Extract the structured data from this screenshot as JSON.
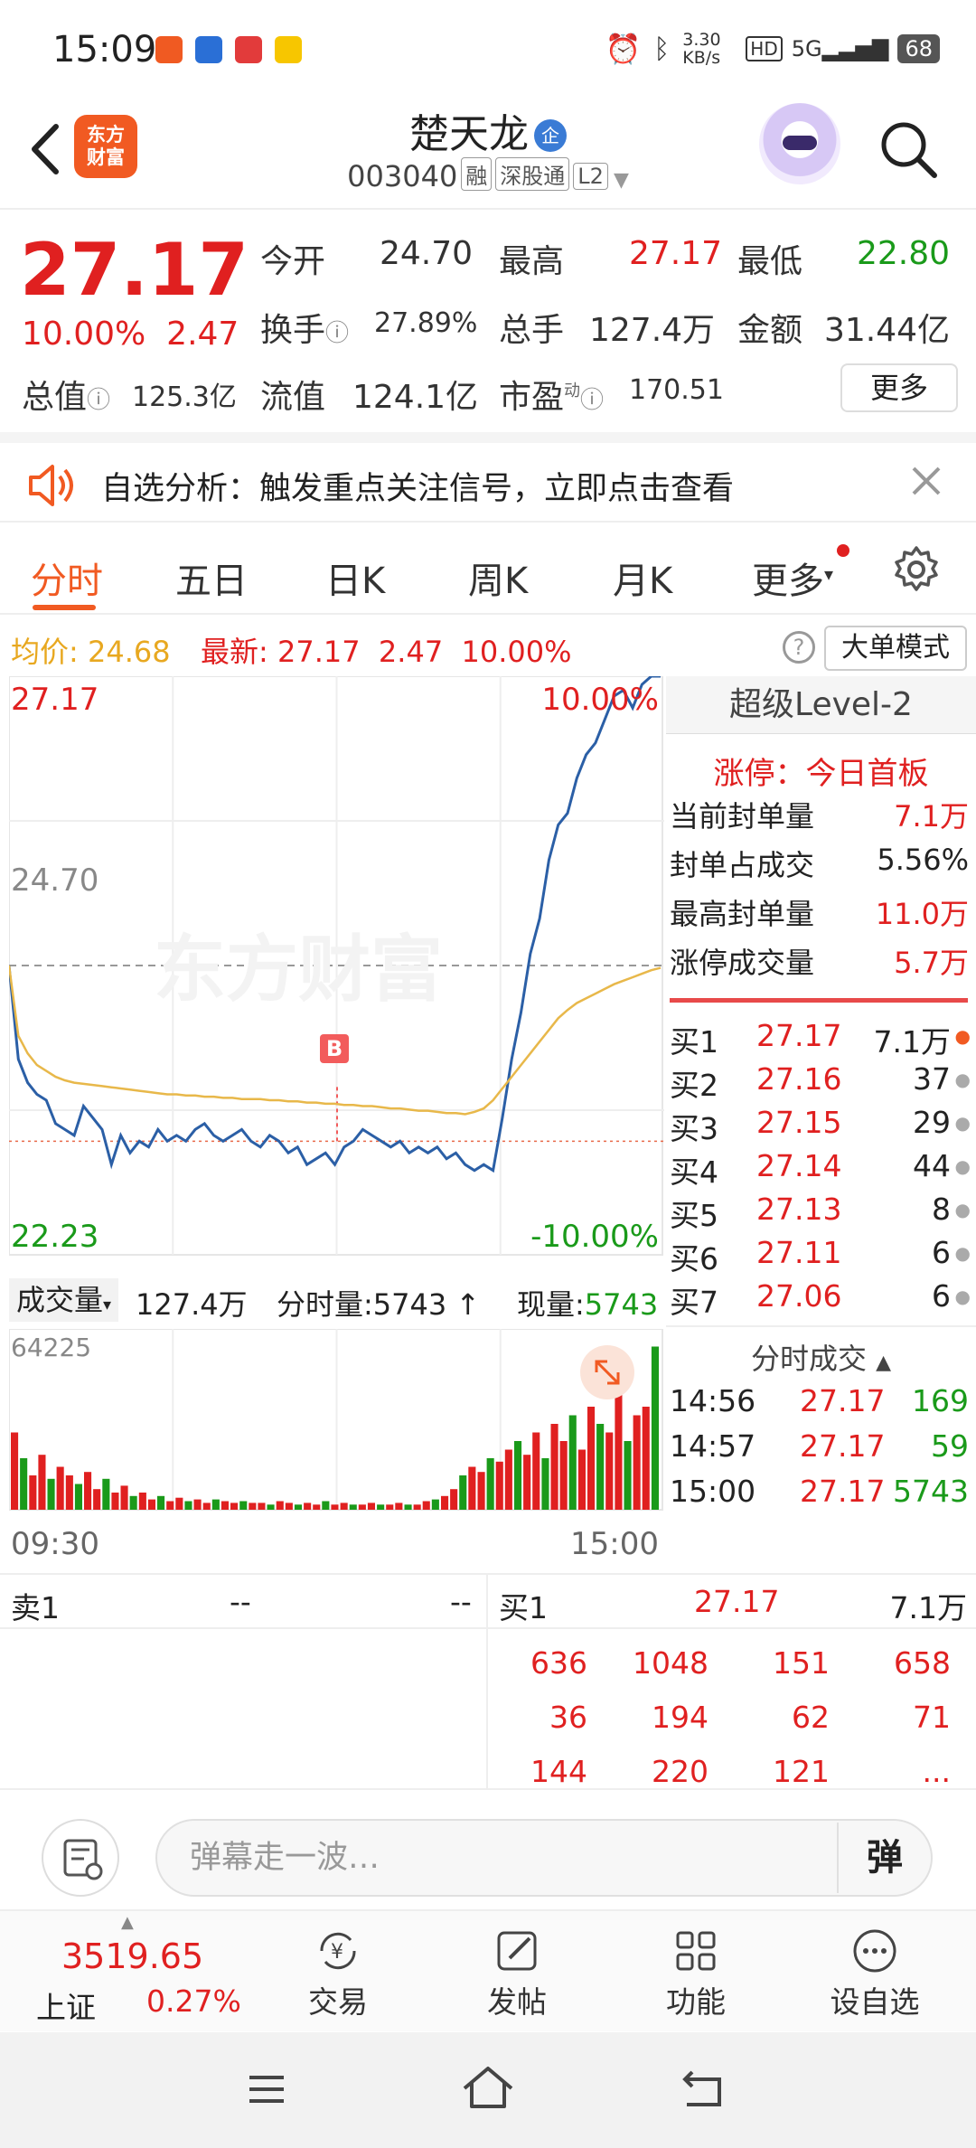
{
  "status_bar": {
    "time": "15:09",
    "net_speed": "3.30 KB/s",
    "battery": "68"
  },
  "header": {
    "logo_line1": "东方",
    "logo_line2": "财富",
    "stock_name": "楚天龙",
    "name_badge": "企",
    "stock_code": "003040",
    "tags": [
      "融",
      "深股通",
      "L2"
    ]
  },
  "quote": {
    "price": "27.17",
    "change_pct": "10.00%",
    "change": "2.47",
    "open_label": "今开",
    "open": "24.70",
    "high_label": "最高",
    "high": "27.17",
    "low_label": "最低",
    "low": "22.80",
    "turnover_label": "换手",
    "turnover": "27.89%",
    "volume_label": "总手",
    "volume": "127.4万",
    "amount_label": "金额",
    "amount": "31.44亿",
    "mcap_label": "总值",
    "mcap": "125.3亿",
    "float_label": "流值",
    "float_cap": "124.1亿",
    "pe_label": "市盈",
    "pe_sup": "动",
    "pe": "170.51",
    "more": "更多"
  },
  "notice": {
    "text": "自选分析：触发重点关注信号，立即点击查看"
  },
  "tabs": [
    "分时",
    "五日",
    "日K",
    "周K",
    "月K",
    "更多"
  ],
  "info_line": {
    "avg_label": "均价:",
    "avg": "24.68",
    "latest_label": "最新:",
    "latest": "27.17",
    "chg": "2.47",
    "pct": "10.00%",
    "mode_btn": "大单模式"
  },
  "chart_labels": {
    "top_left": "27.17",
    "top_right": "10.00%",
    "mid_left": "24.70",
    "bottom_left": "22.23",
    "bottom_right": "-10.00%",
    "marker": "B",
    "watermark": "东方财富"
  },
  "chart_data": {
    "type": "line",
    "ylim": [
      22.23,
      27.17
    ],
    "prev_close": 24.7,
    "x_labels": [
      "09:30",
      "15:00"
    ],
    "series": [
      {
        "values": [
          24.7,
          23.9,
          23.7,
          23.6,
          23.55,
          23.35,
          23.3,
          23.25,
          23.5,
          23.4,
          23.3,
          23.0,
          23.25,
          23.1,
          23.2,
          23.15,
          23.3,
          23.2,
          23.25,
          23.2,
          23.3,
          23.35,
          23.25,
          23.2,
          23.25,
          23.3,
          23.2,
          23.15,
          23.25,
          23.2,
          23.1,
          23.15,
          23.0,
          23.05,
          23.1,
          23.0,
          23.15,
          23.2,
          23.3,
          23.25,
          23.2,
          23.15,
          23.2,
          23.1,
          23.15,
          23.1,
          23.15,
          23.05,
          23.1,
          23.0,
          22.95,
          23.0,
          22.95,
          23.4,
          23.9,
          24.3,
          24.8,
          25.1,
          25.6,
          25.9,
          26.0,
          26.3,
          26.5,
          26.6,
          26.8,
          27.0,
          27.05,
          26.9,
          27.1,
          27.17,
          27.17
        ]
      },
      {
        "values": [
          24.7,
          24.1,
          23.95,
          23.85,
          23.8,
          23.75,
          23.72,
          23.7,
          23.69,
          23.68,
          23.67,
          23.66,
          23.65,
          23.64,
          23.63,
          23.62,
          23.61,
          23.6,
          23.6,
          23.59,
          23.59,
          23.58,
          23.58,
          23.57,
          23.57,
          23.56,
          23.56,
          23.56,
          23.55,
          23.55,
          23.54,
          23.54,
          23.53,
          23.53,
          23.52,
          23.52,
          23.51,
          23.51,
          23.5,
          23.5,
          23.49,
          23.48,
          23.48,
          23.47,
          23.46,
          23.46,
          23.45,
          23.44,
          23.44,
          23.43,
          23.45,
          23.48,
          23.55,
          23.65,
          23.75,
          23.85,
          23.95,
          24.05,
          24.15,
          24.25,
          24.32,
          24.38,
          24.42,
          24.46,
          24.5,
          24.54,
          24.57,
          24.6,
          24.63,
          24.66,
          24.68
        ]
      }
    ]
  },
  "volume": {
    "label": "成交量",
    "total": "127.4万",
    "tick_label": "分时量:",
    "tick_val": "5743",
    "cur_label": "现量:",
    "cur_val": "5743",
    "max_label": "64225",
    "time_start": "09:30",
    "time_end": "15:00",
    "bars": [
      0.45,
      0.3,
      0.2,
      0.32,
      0.18,
      0.25,
      0.2,
      0.15,
      0.22,
      0.12,
      0.18,
      0.1,
      0.14,
      0.08,
      0.1,
      0.06,
      0.08,
      0.05,
      0.07,
      0.05,
      0.06,
      0.04,
      0.06,
      0.05,
      0.04,
      0.05,
      0.04,
      0.04,
      0.03,
      0.05,
      0.04,
      0.03,
      0.04,
      0.03,
      0.05,
      0.03,
      0.04,
      0.03,
      0.03,
      0.04,
      0.03,
      0.03,
      0.04,
      0.03,
      0.03,
      0.05,
      0.06,
      0.08,
      0.12,
      0.2,
      0.25,
      0.22,
      0.3,
      0.28,
      0.35,
      0.4,
      0.32,
      0.45,
      0.3,
      0.5,
      0.4,
      0.55,
      0.35,
      0.6,
      0.5,
      0.45,
      0.7,
      0.4,
      0.55,
      0.6,
      0.95
    ]
  },
  "level2": {
    "title": "超级Level-2",
    "limit_label": "涨停：",
    "limit_val": "今日首板",
    "stats": [
      {
        "label": "当前封单量",
        "value": "7.1万"
      },
      {
        "label": "封单占成交",
        "value": "5.56%"
      },
      {
        "label": "最高封单量",
        "value": "11.0万"
      },
      {
        "label": "涨停成交量",
        "value": "5.7万"
      }
    ],
    "bids": [
      {
        "label": "买1",
        "price": "27.17",
        "vol": "7.1万"
      },
      {
        "label": "买2",
        "price": "27.16",
        "vol": "37"
      },
      {
        "label": "买3",
        "price": "27.15",
        "vol": "29"
      },
      {
        "label": "买4",
        "price": "27.14",
        "vol": "44"
      },
      {
        "label": "买5",
        "price": "27.13",
        "vol": "8"
      },
      {
        "label": "买6",
        "price": "27.11",
        "vol": "6"
      },
      {
        "label": "买7",
        "price": "27.06",
        "vol": "6"
      }
    ],
    "trades_title": "分时成交",
    "trades": [
      {
        "time": "14:56",
        "price": "27.17",
        "vol": "169"
      },
      {
        "time": "14:57",
        "price": "27.17",
        "vol": "59"
      },
      {
        "time": "15:00",
        "price": "27.17",
        "vol": "5743"
      }
    ]
  },
  "book": {
    "sell_label": "卖1",
    "sell_price": "--",
    "sell_vol": "--",
    "buy_label": "买1",
    "buy_price": "27.17",
    "buy_vol": "7.1万",
    "queue": [
      [
        "636",
        "1048",
        "151",
        "658"
      ],
      [
        "36",
        "194",
        "62",
        "71"
      ],
      [
        "144",
        "220",
        "121",
        "..."
      ]
    ]
  },
  "comment_bar": {
    "placeholder": "弹幕走一波…",
    "danmu_btn": "弹"
  },
  "bottom_nav": {
    "index_value": "3519.65",
    "index_name": "上证",
    "index_pct": "0.27%",
    "items": [
      "交易",
      "发帖",
      "功能",
      "设自选"
    ]
  },
  "colors": {
    "up": "#e02020",
    "down": "#1a9a1a",
    "brand": "#f15a22",
    "price_line": "#2b5fa6",
    "avg_line": "#e8b84a"
  }
}
